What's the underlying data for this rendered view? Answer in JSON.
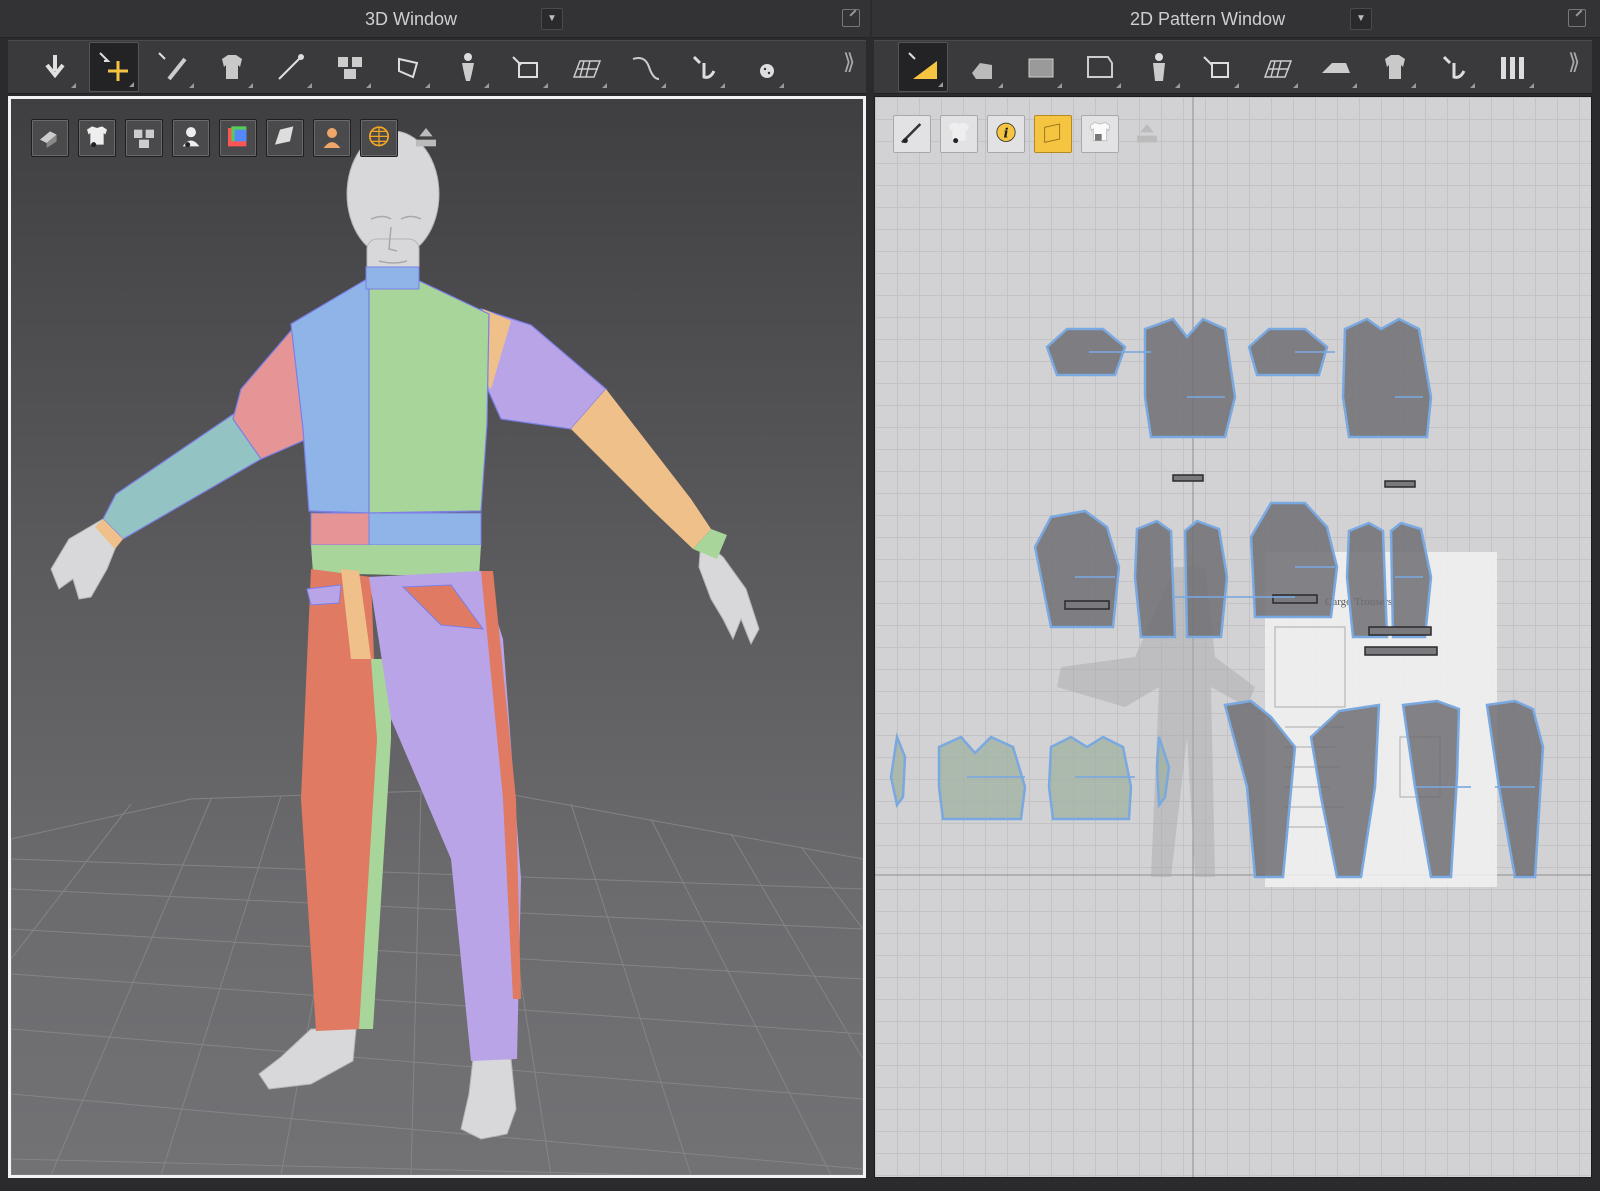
{
  "left_panel": {
    "title": "3D Window",
    "dropdown_glyph": "▼",
    "more_glyph": "⟫",
    "toolbar": [
      {
        "icon": "simulation-arrow-icon",
        "active": false
      },
      {
        "icon": "select-move-icon",
        "active": true
      },
      {
        "icon": "select-mesh-brush-icon",
        "active": false
      },
      {
        "icon": "fold-arrangement-icon",
        "active": false
      },
      {
        "icon": "pin-icon",
        "active": false
      },
      {
        "icon": "show-arrangement-points-icon",
        "active": false
      },
      {
        "icon": "tack-icon",
        "active": false
      },
      {
        "icon": "avatar-measure-icon",
        "active": false
      },
      {
        "icon": "sewing-icon",
        "active": false
      },
      {
        "icon": "grid-tape-icon",
        "active": false
      },
      {
        "icon": "edit-curvature-icon",
        "active": false
      },
      {
        "icon": "trim-icon",
        "active": false
      },
      {
        "icon": "button-icon",
        "active": false
      }
    ],
    "overlay_icons": [
      "show-3d-garment-solid-icon",
      "show-garment-icon",
      "show-arrangement-points-icon",
      "show-avatar-icon",
      "texture-icon",
      "surface-icon",
      "skin-icon",
      "wireframe-globe-icon",
      "upload-icon"
    ]
  },
  "right_panel": {
    "title": "2D Pattern Window",
    "dropdown_glyph": "▼",
    "more_glyph": "⟫",
    "toolbar": [
      {
        "icon": "transform-pattern-icon",
        "active": true
      },
      {
        "icon": "edit-pattern-icon",
        "active": false
      },
      {
        "icon": "polygon-icon",
        "active": false
      },
      {
        "icon": "internal-polygon-icon",
        "active": false
      },
      {
        "icon": "arrangement-avatar-icon",
        "active": false
      },
      {
        "icon": "segment-sewing-icon",
        "active": false
      },
      {
        "icon": "grid-icon",
        "active": false
      },
      {
        "icon": "iron-icon",
        "active": false
      },
      {
        "icon": "fold-garment-icon",
        "active": false
      },
      {
        "icon": "trim-icon",
        "active": false
      },
      {
        "icon": "columns-icon",
        "active": false
      }
    ],
    "overlay_icons": [
      {
        "icon": "show-baseline-icon",
        "on": false
      },
      {
        "icon": "show-garment-icon",
        "on": false
      },
      {
        "icon": "info-icon",
        "on": false
      },
      {
        "icon": "fabric-swatch-icon",
        "on": true
      },
      {
        "icon": "lock-garment-icon",
        "on": false
      },
      {
        "icon": "upload-icon",
        "on": false
      }
    ],
    "reference_sheet_title": "Cargo Trousers"
  },
  "colors": {
    "accent": "#f5c542",
    "blue": "#8fb5e8",
    "green": "#a8d59a",
    "purple": "#b8a4e6",
    "salmon": "#e07a62",
    "peach": "#f0c08a",
    "teal": "#93c3c3",
    "pink": "#e69597",
    "pattern_fill": "#6e6e73",
    "pattern_outline": "#7aa8e0"
  }
}
